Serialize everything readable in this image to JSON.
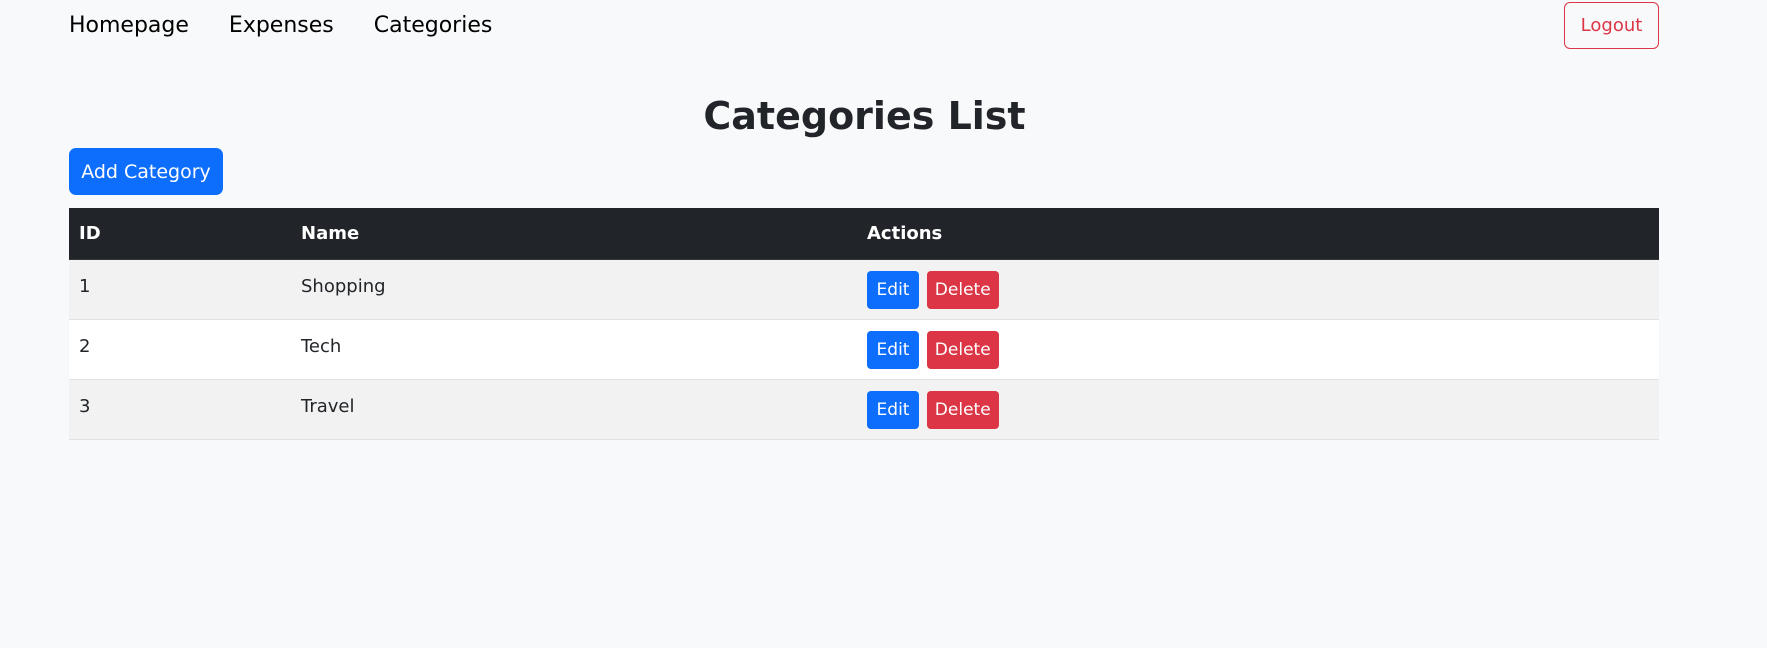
{
  "nav": {
    "links": [
      "Homepage",
      "Expenses",
      "Categories"
    ],
    "logout_label": "Logout"
  },
  "page": {
    "title": "Categories List",
    "add_button_label": "Add Category"
  },
  "table": {
    "headers": [
      "ID",
      "Name",
      "Actions"
    ],
    "rows": [
      {
        "id": "1",
        "name": "Shopping",
        "edit_label": "Edit",
        "delete_label": "Delete"
      },
      {
        "id": "2",
        "name": "Tech",
        "edit_label": "Edit",
        "delete_label": "Delete"
      },
      {
        "id": "3",
        "name": "Travel",
        "edit_label": "Edit",
        "delete_label": "Delete"
      }
    ]
  },
  "colors": {
    "primary": "#0d6efd",
    "danger": "#dc3545",
    "table_header_bg": "#212529",
    "page_bg": "#f8f9fa"
  }
}
